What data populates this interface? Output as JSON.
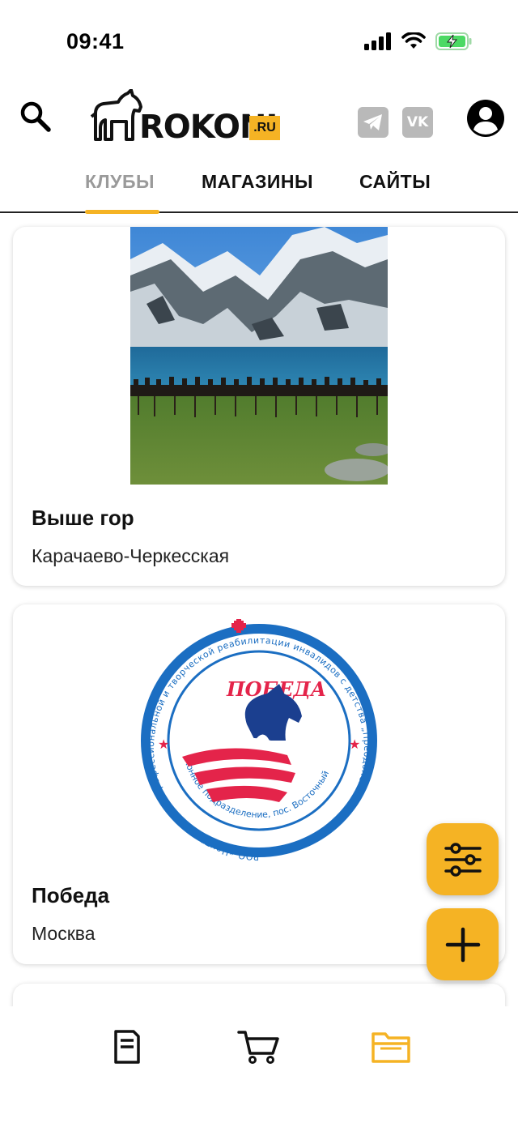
{
  "status_bar": {
    "time": "09:41"
  },
  "header": {
    "logo_text": "ROKONI",
    "logo_domain": ".RU",
    "vk_label": "VK"
  },
  "tabs": [
    {
      "label": "КЛУБЫ",
      "active": true
    },
    {
      "label": "МАГАЗИНЫ",
      "active": false
    },
    {
      "label": "САЙТЫ",
      "active": false
    }
  ],
  "cards": [
    {
      "title": "Выше гор",
      "subtitle": "Карачаево-Черкесская",
      "image": "mountain-lake-riders-photo"
    },
    {
      "title": "Победа",
      "subtitle": "Москва",
      "image": "pobeda-club-logo",
      "logo_title": "ПОБЕДА",
      "logo_ring_text": "РОО «Центр трудовой, профессиональной и творческой реабилитации инвалидов с детства „Преодоление-Л“»",
      "logo_inner_text": "Конное подразделение, пос. Восточный"
    },
    {
      "title": "",
      "subtitle": "",
      "image": "partial-logo"
    }
  ],
  "fabs": {
    "filter": "sliders-icon",
    "add": "plus-icon"
  },
  "bottom_nav": [
    {
      "icon": "document-icon",
      "active": false
    },
    {
      "icon": "cart-icon",
      "active": false
    },
    {
      "icon": "folder-icon",
      "active": true
    }
  ],
  "colors": {
    "accent": "#f5b324",
    "inactive_tab": "#9a9a9a",
    "social_bg": "#b9b9b9"
  }
}
